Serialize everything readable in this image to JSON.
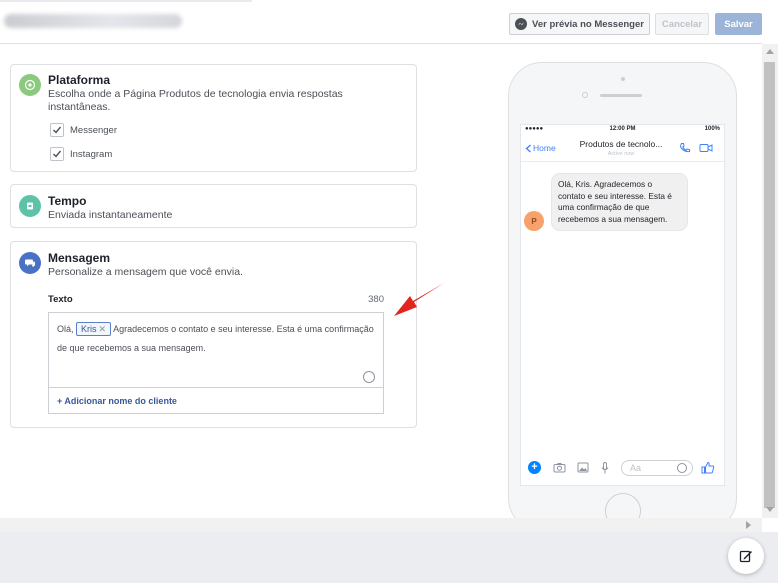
{
  "header": {
    "preview_label": "Ver prévia no Messenger",
    "cancel_label": "Cancelar",
    "save_label": "Salvar"
  },
  "plataforma": {
    "title": "Plataforma",
    "description": "Escolha onde a Página Produtos de tecnologia envia respostas instantâneas.",
    "options": [
      {
        "label": "Messenger",
        "checked": true
      },
      {
        "label": "Instagram",
        "checked": true
      }
    ]
  },
  "tempo": {
    "title": "Tempo",
    "description": "Enviada instantaneamente"
  },
  "mensagem": {
    "title": "Mensagem",
    "description": "Personalize a mensagem que você envia.",
    "field_label": "Texto",
    "char_count": "380",
    "text_before": "Olá, ",
    "token": "Kris",
    "text_after": " Agradecemos o contato e seu interesse. Esta é uma confirmação de que recebemos a sua mensagem.",
    "add_name_label": "+ Adicionar nome do cliente"
  },
  "preview": {
    "status_signal": "●●●●● ",
    "status_time": "12:00 PM",
    "status_battery": "100%",
    "back_label": "Home",
    "chat_name": "Produtos de tecnolo...",
    "chat_status": "Active now",
    "avatar_letter": "P",
    "message": "Olá, Kris. Agradecemos o contato e seu interesse. Esta é uma confirmação de que recebemos a sua mensagem.",
    "composer_placeholder": "Aa"
  },
  "colors": {
    "accent": "#4080ff",
    "save_disabled": "#9cb4d8",
    "annotation_arrow": "#e0261e"
  }
}
